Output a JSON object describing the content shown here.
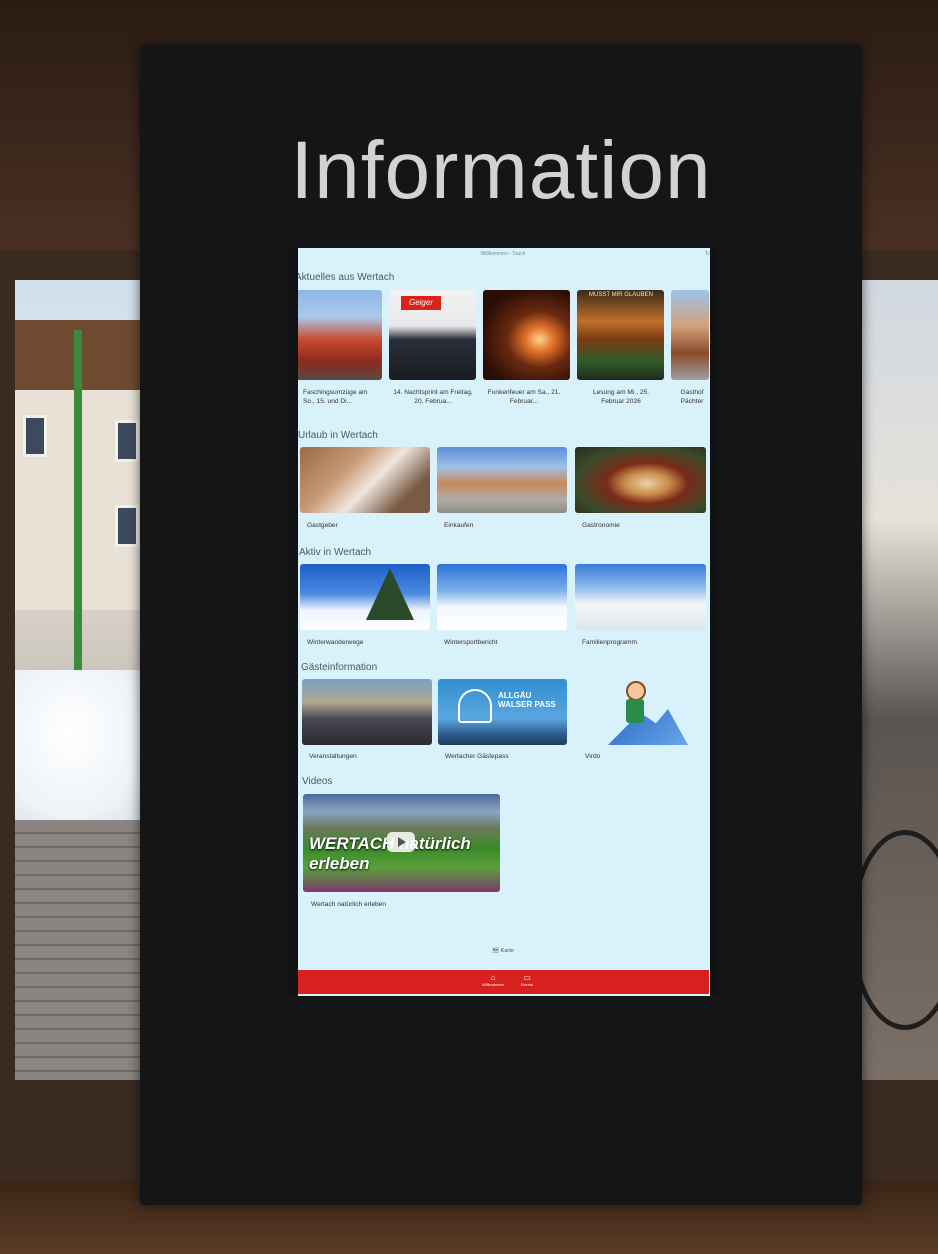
{
  "kiosk": {
    "title": "Information"
  },
  "screen": {
    "window_title": "Willkommen - Touch",
    "refresh_icon": "refresh-icon",
    "sections": [
      {
        "title": "Aktuelles aus Wertach",
        "cards": [
          {
            "label": "Faschingsumzüge am So., 15. und Di...",
            "image": "parade-photo"
          },
          {
            "label": "14. Nachtsprint am Freitag, 20. Februa...",
            "image": "night-sprint-photo"
          },
          {
            "label": "Funkenfeuer am Sa., 21. Februar...",
            "image": "bonfire-photo"
          },
          {
            "label": "Lesung am Mi., 25. Februar 2026",
            "image": "reading-poster"
          },
          {
            "label": "Gasthof Pächter",
            "image": "inn-photo"
          }
        ]
      },
      {
        "title": "Urlaub in Wertach",
        "cards": [
          {
            "label": "Gastgeber",
            "image": "lodging-photo"
          },
          {
            "label": "Einkaufen",
            "image": "village-street-photo"
          },
          {
            "label": "Gastronomie",
            "image": "food-photo"
          }
        ]
      },
      {
        "title": "Aktiv in Wertach",
        "cards": [
          {
            "label": "Winterwanderwege",
            "image": "winter-tree-photo"
          },
          {
            "label": "Wintersportbericht",
            "image": "skiers-photo"
          },
          {
            "label": "Familienprogramm",
            "image": "family-winter-photo"
          }
        ]
      },
      {
        "title": "Gästeinformation",
        "cards": [
          {
            "label": "Veranstaltungen",
            "image": "event-crowd-photo"
          },
          {
            "label": "Wertacher Gästepass",
            "image": "allgaeu-walser-pass-logo"
          },
          {
            "label": "Virdo",
            "image": "mascot-illustration"
          }
        ]
      },
      {
        "title": "Videos",
        "cards": [
          {
            "label": "Wertach natürlich erleben",
            "image": "mountain-video-thumbnail"
          }
        ]
      }
    ],
    "logo_text": {
      "pass": "ALLGÄU WALSER PASS",
      "video": "WERTACH natürlich erleben",
      "poster": "MUSST MIR GLAUBEN"
    },
    "map_link": "Karte",
    "bottom_nav": [
      {
        "label": "Willkommen",
        "icon": "home-icon"
      },
      {
        "label": "Events",
        "icon": "chat-icon"
      }
    ],
    "colors": {
      "screen_bg": "#d9f1fb",
      "nav_bar": "#d7211f",
      "kiosk": "#141517"
    }
  }
}
